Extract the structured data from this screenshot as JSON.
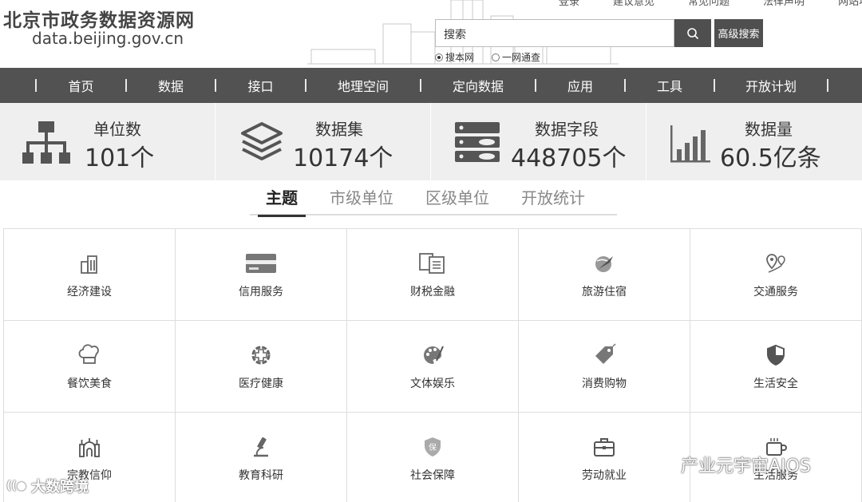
{
  "header": {
    "site_title": "北京市政务数据资源网",
    "site_url": "data.beijing.gov.cn",
    "top_links": [
      "登录",
      "建议意见",
      "常见问题",
      "法律声明",
      "网站地图"
    ],
    "search_placeholder": "搜索",
    "advanced_search_label": "高级搜索",
    "search_scope": [
      {
        "label": "搜本网",
        "selected": true
      },
      {
        "label": "一网通查",
        "selected": false
      }
    ]
  },
  "nav": {
    "items": [
      "首页",
      "数据",
      "接口",
      "地理空间",
      "定向数据",
      "应用",
      "工具",
      "开放计划"
    ]
  },
  "stats": [
    {
      "label": "单位数",
      "value": "101个",
      "icon": "org-chart-icon"
    },
    {
      "label": "数据集",
      "value": "10174个",
      "icon": "layers-icon"
    },
    {
      "label": "数据字段",
      "value": "448705个",
      "icon": "database-icon"
    },
    {
      "label": "数据量",
      "value": "60.5亿条",
      "icon": "bar-chart-icon"
    }
  ],
  "tabs": [
    {
      "label": "主题",
      "active": true
    },
    {
      "label": "市级单位",
      "active": false
    },
    {
      "label": "区级单位",
      "active": false
    },
    {
      "label": "开放统计",
      "active": false
    }
  ],
  "categories": [
    {
      "label": "经济建设",
      "icon": "building-icon"
    },
    {
      "label": "信用服务",
      "icon": "credit-card-icon"
    },
    {
      "label": "财税金融",
      "icon": "tax-document-icon"
    },
    {
      "label": "旅游住宿",
      "icon": "plane-globe-icon"
    },
    {
      "label": "交通服务",
      "icon": "route-pin-icon"
    },
    {
      "label": "餐饮美食",
      "icon": "chef-hat-icon"
    },
    {
      "label": "医疗健康",
      "icon": "medical-cross-icon"
    },
    {
      "label": "文体娱乐",
      "icon": "palette-icon"
    },
    {
      "label": "消费购物",
      "icon": "price-tag-icon"
    },
    {
      "label": "生活安全",
      "icon": "shield-icon"
    },
    {
      "label": "宗教信仰",
      "icon": "temple-icon"
    },
    {
      "label": "教育科研",
      "icon": "microscope-icon"
    },
    {
      "label": "社会保障",
      "icon": "guarantee-shield-icon"
    },
    {
      "label": "劳动就业",
      "icon": "briefcase-icon"
    },
    {
      "label": "生活服务",
      "icon": "coffee-cup-icon"
    }
  ],
  "watermarks": {
    "left": "大数跨境",
    "right": "产业元宇宙AIOS"
  },
  "colors": {
    "nav_bg": "#525252",
    "stats_bg": "#efefef",
    "button_bg": "#4f4f4f"
  }
}
